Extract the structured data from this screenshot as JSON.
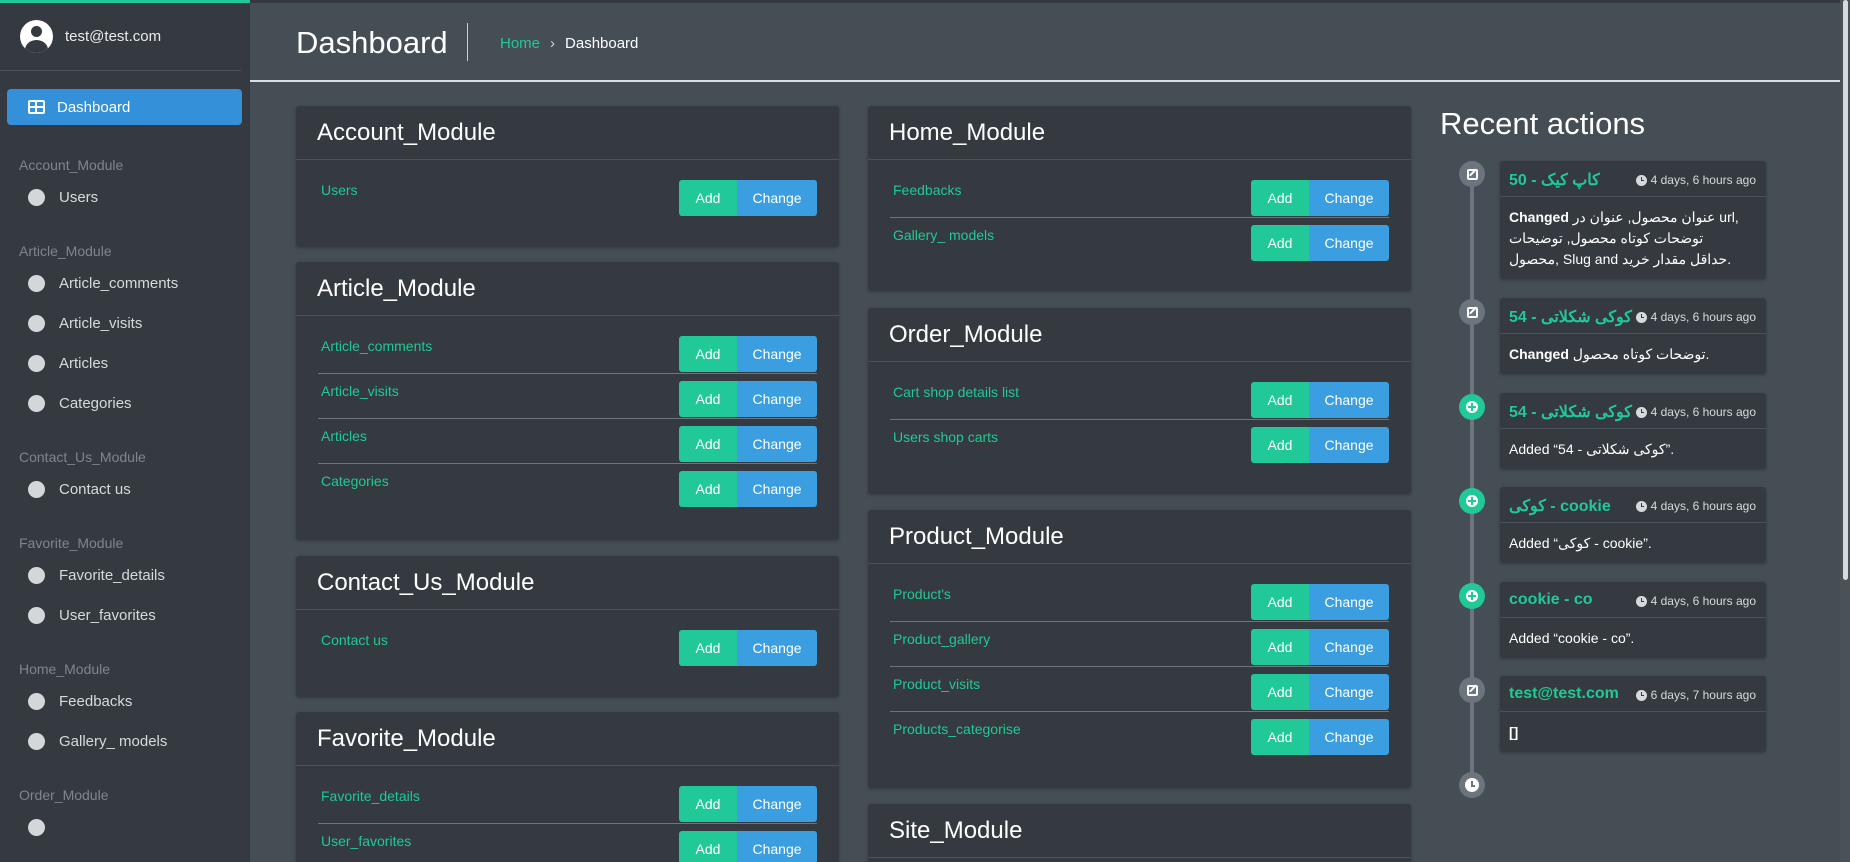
{
  "user": {
    "email": "test@test.com"
  },
  "nav": {
    "active": "Dashboard",
    "groups": [
      {
        "header": "Account_Module",
        "items": [
          "Users"
        ]
      },
      {
        "header": "Article_Module",
        "items": [
          "Article_comments",
          "Article_visits",
          "Articles",
          "Categories"
        ]
      },
      {
        "header": "Contact_Us_Module",
        "items": [
          "Contact us"
        ]
      },
      {
        "header": "Favorite_Module",
        "items": [
          "Favorite_details",
          "User_favorites"
        ]
      },
      {
        "header": "Home_Module",
        "items": [
          "Feedbacks",
          "Gallery_ models"
        ]
      },
      {
        "header": "Order_Module",
        "items": []
      }
    ]
  },
  "header": {
    "title": "Dashboard",
    "breadcrumb_home": "Home",
    "breadcrumb_sep": "›",
    "breadcrumb_current": "Dashboard"
  },
  "buttons": {
    "add": "Add",
    "change": "Change"
  },
  "modules": [
    {
      "title": "Account_Module",
      "items": [
        "Users"
      ]
    },
    {
      "title": "Article_Module",
      "items": [
        "Article_comments",
        "Article_visits",
        "Articles",
        "Categories"
      ]
    },
    {
      "title": "Contact_Us_Module",
      "items": [
        "Contact us"
      ]
    },
    {
      "title": "Favorite_Module",
      "items": [
        "Favorite_details",
        "User_favorites"
      ]
    },
    {
      "title": "Home_Module",
      "items": [
        "Feedbacks",
        "Gallery_ models"
      ]
    },
    {
      "title": "Order_Module",
      "items": [
        "Cart shop details list",
        "Users shop carts"
      ]
    },
    {
      "title": "Product_Module",
      "items": [
        "Product's",
        "Product_gallery",
        "Product_visits",
        "Products_categorise"
      ]
    },
    {
      "title": "Site_Module",
      "items": []
    }
  ],
  "recent": {
    "title": "Recent actions",
    "actions": [
      {
        "type": "edit",
        "object": "50 - کاپ کیک",
        "time": "4 days, 6 hours ago",
        "verb": "Changed",
        "detail": "عنوان محصول, عنوان در url, توضحات کوتاه محصول, توضیحات محصول, Slug and حداقل مقدار خرید."
      },
      {
        "type": "edit",
        "object": "54 - کوکی شکلاتی",
        "time": "4 days, 6 hours ago",
        "verb": "Changed",
        "detail": "توضحات کوتاه محصول."
      },
      {
        "type": "add",
        "object": "54 - کوکی شکلاتی",
        "time": "4 days, 6 hours ago",
        "verb": "",
        "detail": "Added “54 - کوکی شکلاتی”."
      },
      {
        "type": "add",
        "object": "کوکی - cookie",
        "time": "4 days, 6 hours ago",
        "verb": "",
        "detail": "Added “کوکی - cookie”."
      },
      {
        "type": "add",
        "object": "cookie - co",
        "time": "4 days, 6 hours ago",
        "verb": "",
        "detail": "Added “cookie - co”."
      },
      {
        "type": "edit",
        "object": "test@test.com",
        "time": "6 days, 7 hours ago",
        "verb": "",
        "detail": "[]"
      }
    ]
  },
  "icons": {
    "user": "user-avatar-icon",
    "dashboard": "dashboard-grid-icon",
    "nav_item": "circle-icon",
    "edit": "edit-icon",
    "add": "plus-circle-icon",
    "clock": "clock-icon"
  },
  "colors": {
    "accent": "#20c997",
    "primary": "#3b9ee0",
    "sidebar": "#343a40",
    "background": "#454d55"
  }
}
